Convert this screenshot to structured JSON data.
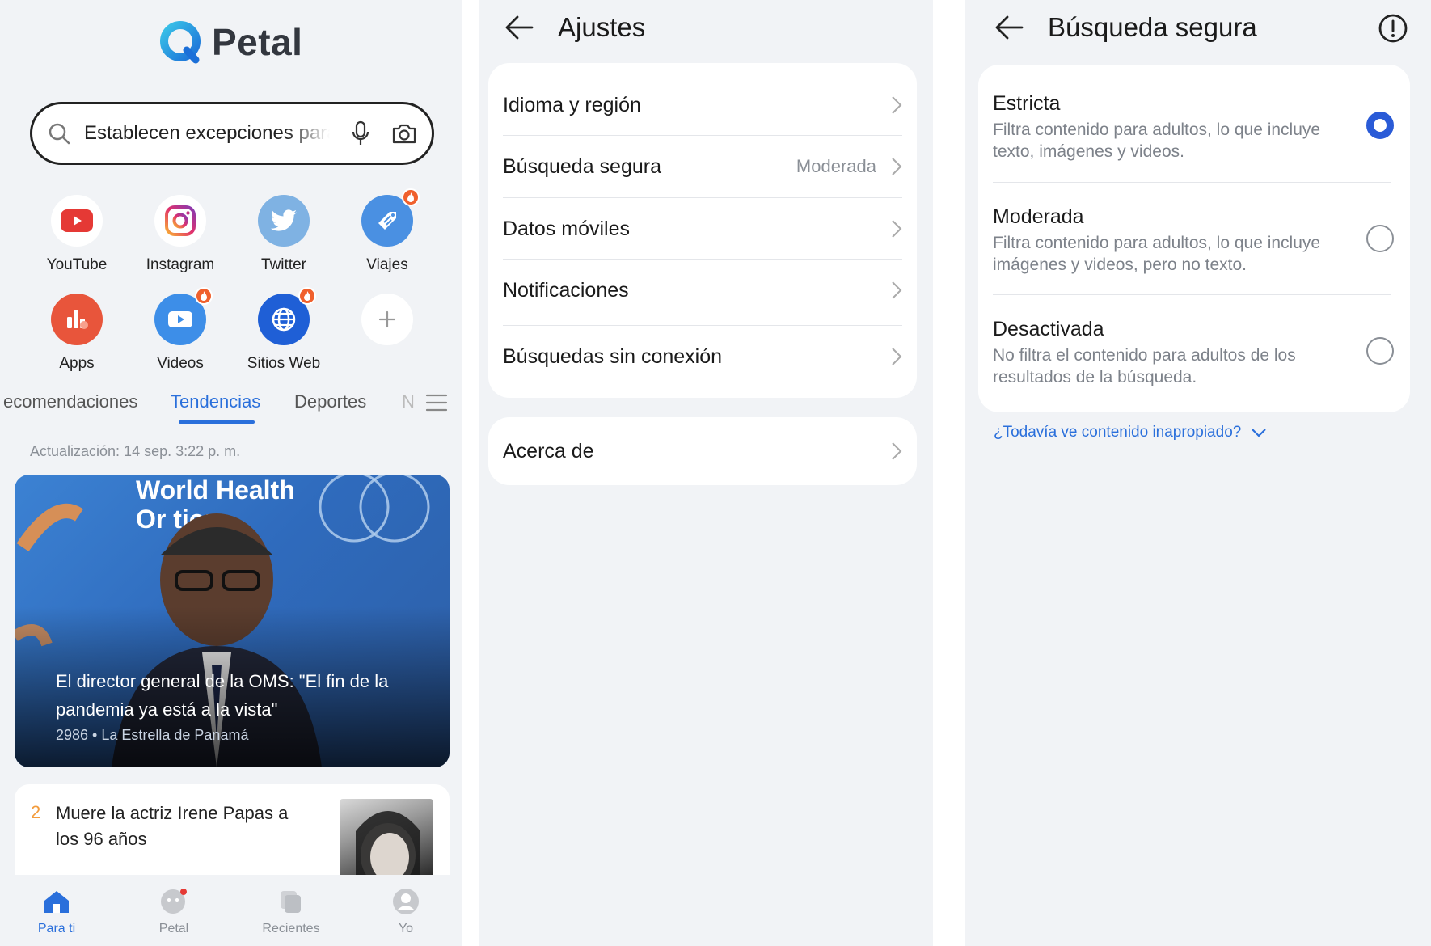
{
  "home": {
    "logo_text": "Petal",
    "search": {
      "query": "Establecen excepciones para"
    },
    "shortcuts": [
      {
        "label": "YouTube",
        "icon": "youtube-icon",
        "color": "#e53935"
      },
      {
        "label": "Instagram",
        "icon": "instagram-icon",
        "color": "#d6249f"
      },
      {
        "label": "Twitter",
        "icon": "twitter-icon",
        "color": "#6fa8dc"
      },
      {
        "label": "Viajes",
        "icon": "travel-icon",
        "color": "#4a90e2"
      },
      {
        "label": "Apps",
        "icon": "apps-icon",
        "color": "#e8553b"
      },
      {
        "label": "Videos",
        "icon": "videos-icon",
        "color": "#3d8ee8"
      },
      {
        "label": "Sitios Web",
        "icon": "globe-icon",
        "color": "#1f5fd6"
      },
      {
        "label": "",
        "icon": "add-icon",
        "color": "#ffffff"
      }
    ],
    "tabs": [
      "ecomendaciones",
      "Tendencias",
      "Deportes",
      "N"
    ],
    "active_tab": "Tendencias",
    "update_text": "Actualización: 14 sep. 3:22 p. m.",
    "featured": {
      "title": "El director general de la OMS: \"El fin de la pandemia ya está a la vista\"",
      "meta": "2986 • La Estrella de Panamá",
      "image_text": "World Health Organization"
    },
    "news_item": {
      "rank": "2",
      "title": "Muere la actriz Irene Papas a los 96 años"
    },
    "bottom_nav": [
      "Para ti",
      "Petal",
      "Recientes",
      "Yo"
    ],
    "accent": "#2a6fdb"
  },
  "settings": {
    "title": "Ajustes",
    "items": [
      {
        "label": "Idioma y región",
        "value": ""
      },
      {
        "label": "Búsqueda segura",
        "value": "Moderada"
      },
      {
        "label": "Datos móviles",
        "value": ""
      },
      {
        "label": "Notificaciones",
        "value": ""
      },
      {
        "label": "Búsquedas sin conexión",
        "value": ""
      }
    ],
    "about": "Acerca de"
  },
  "safe_search": {
    "title": "Búsqueda segura",
    "options": [
      {
        "title": "Estricta",
        "desc": "Filtra contenido para adultos, lo que incluye texto, imágenes y videos.",
        "selected": true
      },
      {
        "title": "Moderada",
        "desc": "Filtra contenido para adultos, lo que incluye imágenes y videos, pero no texto.",
        "selected": false
      },
      {
        "title": "Desactivada",
        "desc": "No filtra el contenido para adultos de los resultados de la búsqueda.",
        "selected": false
      }
    ],
    "help_link": "¿Todavía ve contenido inapropiado?",
    "selected_color": "#2a5bd7"
  }
}
